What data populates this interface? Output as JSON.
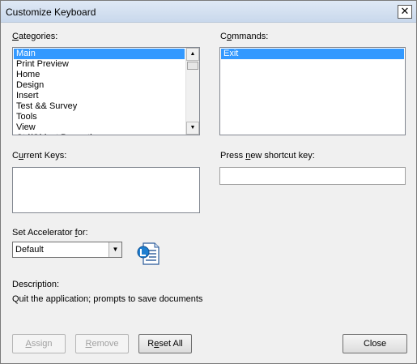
{
  "window": {
    "title": "Customize Keyboard"
  },
  "categories": {
    "label_pre": "",
    "label_u": "C",
    "label_post": "ategories:",
    "items": [
      "Main",
      "Print Preview",
      "Home",
      "Design",
      "Insert",
      "Test && Survey",
      "Tools",
      "View",
      "Ctrl/Object Properties"
    ],
    "selected_index": 0
  },
  "commands": {
    "label_pre": "C",
    "label_u": "o",
    "label_post": "mmands:",
    "items": [
      "Exit"
    ],
    "selected_index": 0
  },
  "current_keys": {
    "label_pre": "C",
    "label_u": "u",
    "label_post": "rrent Keys:"
  },
  "shortcut": {
    "label_pre": "Press ",
    "label_u": "n",
    "label_post": "ew shortcut key:",
    "value": ""
  },
  "accelerator": {
    "label_pre": "Set Accelerator ",
    "label_u": "f",
    "label_post": "or:",
    "selected": "Default"
  },
  "description": {
    "label": "Description:",
    "text": "Quit the application; prompts to save documents"
  },
  "buttons": {
    "assign_u": "A",
    "assign_rest": "ssign",
    "remove_u": "R",
    "remove_rest": "emove",
    "reset_pre": "R",
    "reset_u": "e",
    "reset_post": "set All",
    "close": "Close"
  },
  "colors": {
    "selection": "#3399ff",
    "dialog_bg": "#f0f0f0"
  }
}
